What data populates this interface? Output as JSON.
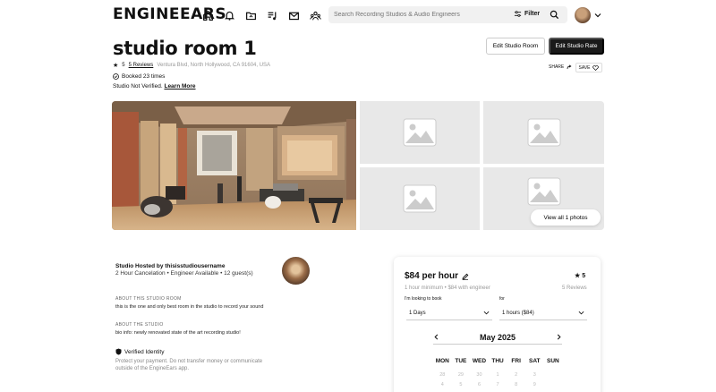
{
  "header": {
    "logo": "ENGINEEARS",
    "search_placeholder": "Search Recording Studios & Audio Engineers",
    "filter_label": "Filter",
    "nav_icons": [
      "home-icon",
      "bell-icon",
      "folder-icon",
      "music-icon",
      "mail-icon",
      "community-icon"
    ]
  },
  "studio": {
    "title": "studio room 1",
    "rating": "5",
    "reviews_link": "5 Reviews",
    "address": "Ventura Blvd, North Hollywood, CA 91604, USA",
    "booked": "Booked 23 times",
    "not_verified": "Studio Not Verified.",
    "learn_more": "Learn More",
    "edit_room": "Edit Studio Room",
    "edit_rate": "Edit Studio Rate",
    "share": "SHARE",
    "save": "SAVE",
    "view_all": "View all 1 photos"
  },
  "host": {
    "title": "Studio Hosted by thisisstudiousername",
    "subtitle": "2 Hour Cancelation • Engineer Available • 12 guest(s)",
    "about_room_label": "ABOUT THIS STUDIO ROOM",
    "about_room_text": "this is the one and only best room in the studio to record your sound",
    "about_studio_label": "ABOUT THE STUDIO",
    "about_studio_text": "bio info: newly renovated state of the art recording studio!",
    "verified_label": "Verified Identity",
    "protect_text": "Protect your payment. Do not transfer money or communicate outside of the EngineEars app."
  },
  "booking": {
    "price": "$84 per hour",
    "rating": "5",
    "min_line": "1 hour minimum • $84 with engineer",
    "reviews": "5 Reviews",
    "looking_label": "I'm looking to book",
    "for_label": "for",
    "days_value": "1 Days",
    "hours_value": "1 hours ($84)",
    "month": "May 2025",
    "weekdays": [
      "MON",
      "TUE",
      "WED",
      "THU",
      "FRI",
      "SAT",
      "SUN"
    ],
    "dates_row1": [
      "28",
      "29",
      "30",
      "1",
      "2",
      "3",
      "4"
    ],
    "dates_row2": [
      "5",
      "6",
      "7",
      "8",
      "9",
      "10",
      "11"
    ]
  },
  "colors": {
    "primary_dark": "#1a1a1a",
    "placeholder_bg": "#e8e8e8",
    "muted_text": "#999999"
  }
}
